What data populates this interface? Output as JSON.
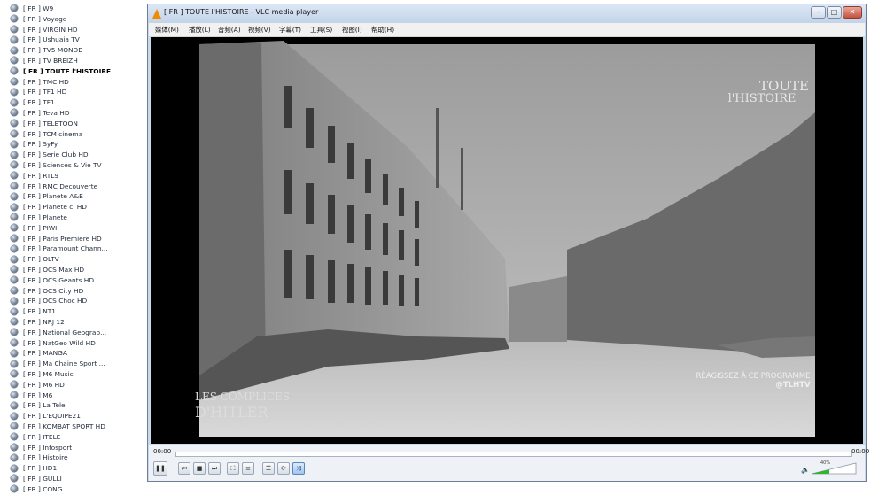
{
  "channels": [
    "[ FR ] W9",
    "[ FR ] Voyage",
    "[ FR ] VIRGIN HD",
    "[ FR ] Ushuaia TV",
    "[ FR ] TV5 MONDE",
    "[ FR ] TV BREIZH",
    "[ FR ] TOUTE l'HISTOIRE",
    "[ FR ] TMC HD",
    "[ FR ] TF1 HD",
    "[ FR ] TF1",
    "[ FR ] Teva HD",
    "[ FR ] TELETOON",
    "[ FR ] TCM cinema",
    "[ FR ] SyFy",
    "[ FR ] Serie Club HD",
    "[ FR ] Sciences & Vie TV",
    "[ FR ] RTL9",
    "[ FR ] RMC Decouverte",
    "[ FR ] Planete A&E",
    "[ FR ] Planete  ci HD",
    "[ FR ] Planete",
    "[ FR ] PIWI",
    "[ FR ] Paris Premiere HD",
    "[ FR ] Paramount Chann...",
    "[ FR ] OLTV",
    "[ FR ] OCS Max HD",
    "[ FR ] OCS Geants HD",
    "[ FR ] OCS City HD",
    "[ FR ] OCS Choc HD",
    "[ FR ] NT1",
    "[ FR ] NRJ 12",
    "[ FR ] National Geograp...",
    "[ FR ] NatGeo Wild HD",
    "[ FR ] MANGA",
    "[ FR ] Ma Chaine Sport ...",
    "[ FR ] M6 Music",
    "[ FR ] M6  HD",
    "[ FR ] M6",
    "[ FR ] La Tele",
    "[ FR ] L'EQUIPE21",
    "[ FR ] KOMBAT SPORT HD",
    "[ FR ] ITELE",
    "[ FR ] Infosport",
    "[ FR ] Histoire",
    "[ FR ] HD1",
    "[ FR ] GULLI",
    "[ FR ] CONG"
  ],
  "active_channel_index": 6,
  "window": {
    "title": "[ FR ] TOUTE l'HISTOIRE - VLC media player",
    "minimize": "–",
    "maximize": "□",
    "close": "✕"
  },
  "menu": [
    "媒体(M)",
    "播放(L)",
    "音频(A)",
    "视频(V)",
    "字幕(T)",
    "工具(S)",
    "视图(I)",
    "帮助(H)"
  ],
  "video": {
    "logo_line1": "TOUTE",
    "logo_line2": "l'HISTOIRE",
    "caption_line1": "RÉAGISSEZ À CE PROGRAMME",
    "caption_line2": "@TLHTV",
    "show_title_line1": "LES COMPLICES",
    "show_title_line2": "D'HITLER"
  },
  "controls": {
    "time_elapsed": "00:00",
    "time_total": "00:00",
    "volume": "40%",
    "volume_level": 0.4,
    "buttons": [
      {
        "name": "pause-button",
        "glyph": "❚❚"
      },
      {
        "name": "previous-button",
        "glyph": "⏮"
      },
      {
        "name": "stop-button",
        "glyph": "■"
      },
      {
        "name": "next-button",
        "glyph": "⏭"
      },
      {
        "name": "fullscreen-button",
        "glyph": "⛶"
      },
      {
        "name": "extended-settings-button",
        "glyph": "≡"
      },
      {
        "name": "playlist-button",
        "glyph": "☰"
      },
      {
        "name": "loop-button",
        "glyph": "⟳"
      },
      {
        "name": "random-button",
        "glyph": "⤨"
      }
    ]
  },
  "colors": {
    "window_frame": "#c9d9ec",
    "vlc_orange": "#f08a00",
    "video_bg": "#000000"
  }
}
